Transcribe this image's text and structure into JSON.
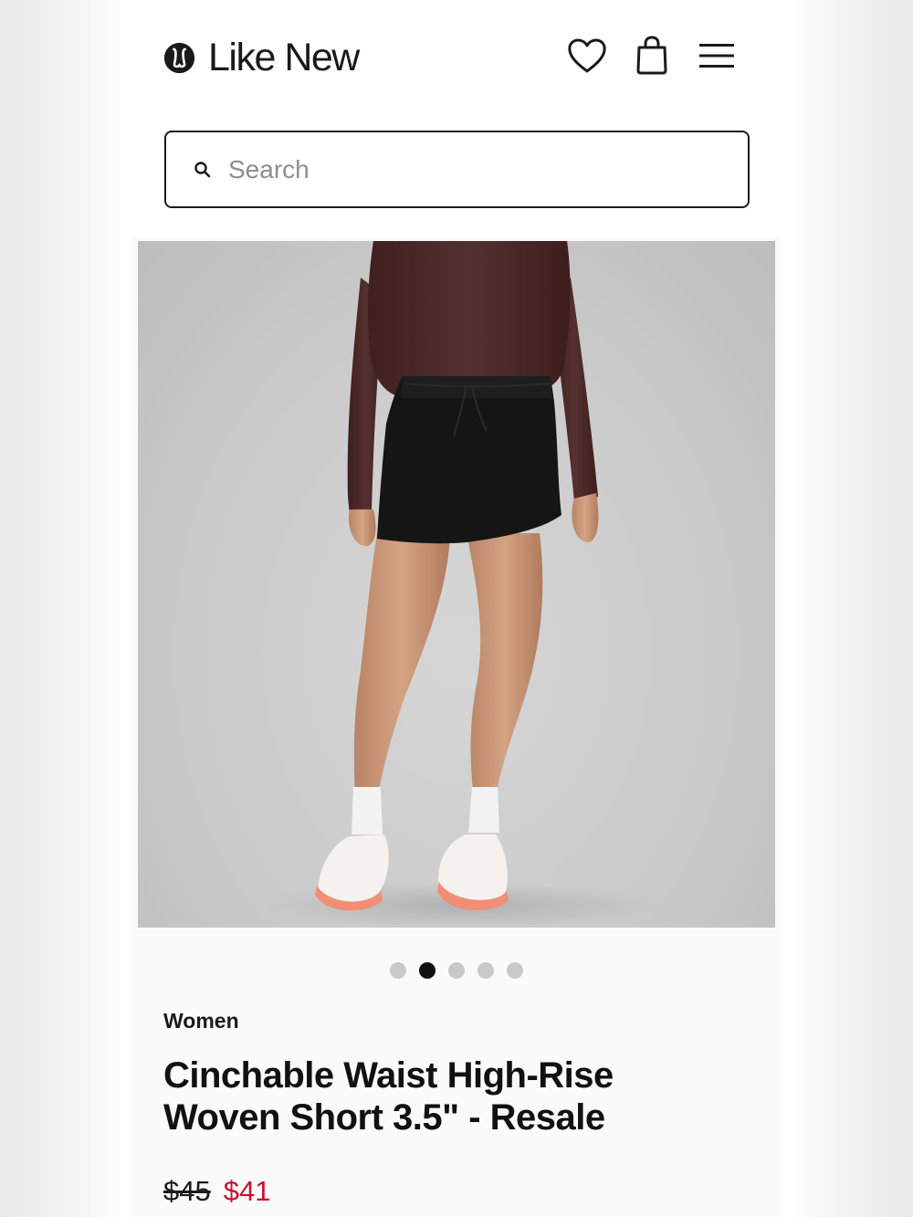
{
  "header": {
    "brand_name": "Like New",
    "logo_icon": "lululemon-logo-icon",
    "icons": [
      "heart-icon",
      "shopping-bag-icon",
      "hamburger-menu-icon"
    ]
  },
  "search": {
    "placeholder": "Search",
    "value": "",
    "icon": "search-icon"
  },
  "gallery": {
    "image_count": 5,
    "active_index": 1
  },
  "product": {
    "category": "Women",
    "title": "Cinchable Waist High-Rise Woven Short 3.5\" - Resale",
    "original_price": "$45",
    "sale_price": "$41"
  },
  "colors": {
    "text": "#1a1a1a",
    "sale_price": "#c8102e",
    "dot_active": "#111111",
    "dot_inactive": "#c9c9c9"
  }
}
